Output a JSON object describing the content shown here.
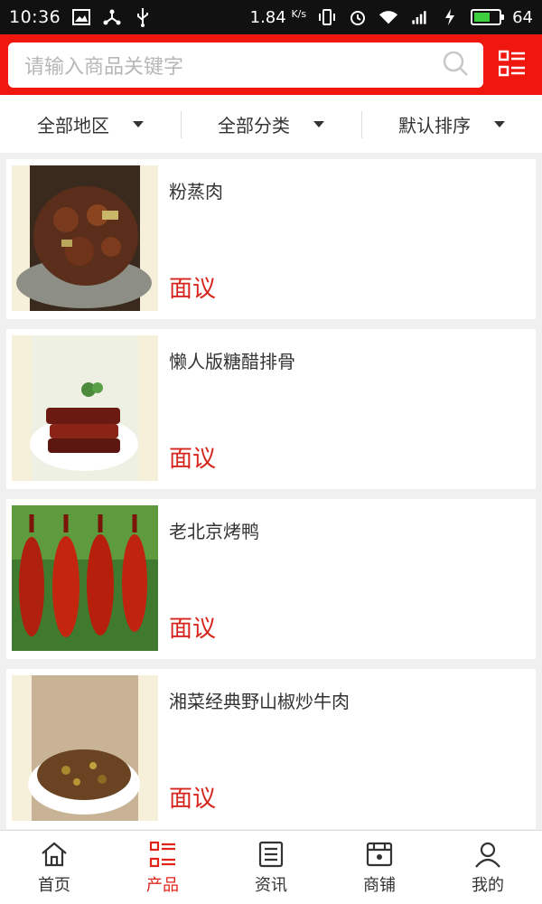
{
  "status_bar": {
    "time": "10:36",
    "net_speed": "1.84",
    "net_unit": "K/s",
    "battery": "64",
    "battery_level": 0.64,
    "icons": [
      "image-icon",
      "share-icon",
      "usb-icon",
      "vibrate-icon",
      "alarm-icon",
      "wifi-icon",
      "signal-4g-icon",
      "charging-icon",
      "battery-icon"
    ]
  },
  "search": {
    "placeholder": "请输入商品关键字",
    "search_icon": "search-icon",
    "menu_icon": "list-menu-icon"
  },
  "filters": [
    {
      "label": "全部地区"
    },
    {
      "label": "全部分类"
    },
    {
      "label": "默认排序"
    }
  ],
  "products": [
    {
      "title": "粉蒸肉",
      "price": "面议",
      "image": "steamed-pork-image"
    },
    {
      "title": "懒人版糖醋排骨",
      "price": "面议",
      "image": "sweet-sour-ribs-image"
    },
    {
      "title": "老北京烤鸭",
      "price": "面议",
      "image": "roast-duck-image"
    },
    {
      "title": "湘菜经典野山椒炒牛肉",
      "price": "面议",
      "image": "pepper-beef-image"
    }
  ],
  "nav": [
    {
      "label": "首页",
      "icon": "home-icon",
      "active": false
    },
    {
      "label": "产品",
      "icon": "product-list-icon",
      "active": true
    },
    {
      "label": "资讯",
      "icon": "news-icon",
      "active": false
    },
    {
      "label": "商铺",
      "icon": "store-icon",
      "active": false
    },
    {
      "label": "我的",
      "icon": "user-icon",
      "active": false
    }
  ],
  "colors": {
    "brand": "#f0180e",
    "price": "#d6251c",
    "nav_active": "#e2231a"
  }
}
